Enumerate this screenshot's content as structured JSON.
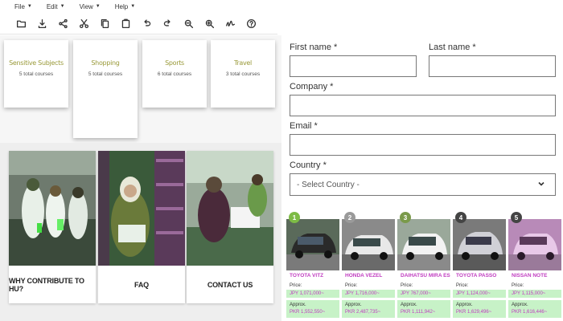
{
  "menu": {
    "file": "File",
    "edit": "Edit",
    "view": "View",
    "help": "Help"
  },
  "toolbar": {
    "icons": [
      "open-folder-icon",
      "download-icon",
      "share-icon",
      "cut-icon",
      "copy-icon",
      "paste-icon",
      "undo-icon",
      "redo-icon",
      "zoom-out-icon",
      "zoom-in-icon",
      "signature-icon",
      "help-icon"
    ]
  },
  "categories": [
    {
      "name": "Sensitive Subjects",
      "count": "5 total courses"
    },
    {
      "name": "Shopping",
      "count": "5 total courses"
    },
    {
      "name": "Sports",
      "count": "6 total courses"
    },
    {
      "name": "Travel",
      "count": "3 total courses"
    }
  ],
  "tiles": [
    {
      "label": "WHY CONTRIBUTE TO HU?"
    },
    {
      "label": "FAQ"
    },
    {
      "label": "CONTACT US"
    }
  ],
  "form": {
    "first_name_label": "First name *",
    "last_name_label": "Last name *",
    "company_label": "Company *",
    "email_label": "Email *",
    "country_label": "Country *",
    "country_value": "- Select Country -"
  },
  "cars": {
    "price_label": "Price:",
    "approx_label": "Approx.",
    "items": [
      {
        "rank": "1",
        "name": "TOYOTA VITZ",
        "price": "JPY 1,071,000~",
        "approx": "PKR 1,552,550~"
      },
      {
        "rank": "2",
        "name": "HONDA VEZEL",
        "price": "JPY 1,716,000~",
        "approx": "PKR 2,487,735~"
      },
      {
        "rank": "3",
        "name": "DAIHATSU MIRA ES",
        "price": "JPY 767,000~",
        "approx": "PKR 1,111,942~"
      },
      {
        "rank": "4",
        "name": "TOYOTA PASSO",
        "price": "JPY 1,124,000~",
        "approx": "PKR 1,629,496~"
      },
      {
        "rank": "5",
        "name": "NISSAN NOTE",
        "price": "JPY 1,115,000~",
        "approx": "PKR 1,616,446~"
      }
    ]
  },
  "colors": {
    "accent_magenta": "#c03cc0",
    "band_green": "#c7f2c7",
    "category_olive": "#9a9a3a"
  }
}
